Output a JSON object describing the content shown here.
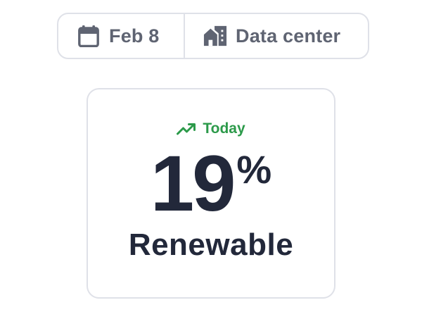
{
  "filters": {
    "date": {
      "label": "Feb 8",
      "icon": "calendar-icon"
    },
    "location": {
      "label": "Data center",
      "icon": "building-icon"
    }
  },
  "metric_card": {
    "trend_label": "Today",
    "trend_icon": "trending-up-icon",
    "value": "19",
    "unit": "%",
    "label": "Renewable"
  },
  "colors": {
    "text_primary": "#22283a",
    "text_secondary": "#5f6472",
    "trend_green": "#2c9a4a",
    "border": "#dfe1e8"
  }
}
